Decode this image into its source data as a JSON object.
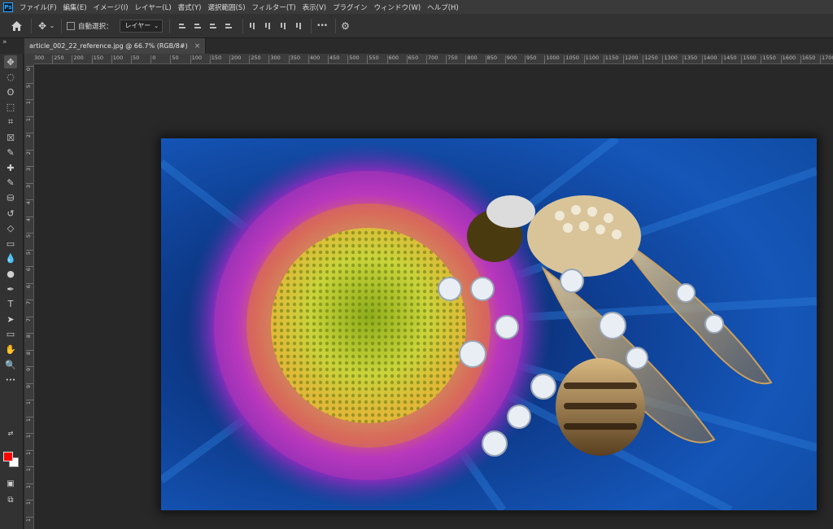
{
  "menubar": {
    "logo": "Ps",
    "items": [
      "ファイル(F)",
      "編集(E)",
      "イメージ(I)",
      "レイヤー(L)",
      "書式(Y)",
      "選択範囲(S)",
      "フィルター(T)",
      "表示(V)",
      "プラグイン",
      "ウィンドウ(W)",
      "ヘルプ(H)"
    ]
  },
  "options": {
    "auto_select_label": "自動選択：",
    "layer_select": "レイヤー",
    "more": "•••"
  },
  "document": {
    "tab_title": "article_002_22_reference.jpg @ 66.7% (RGB/8#)",
    "close": "×"
  },
  "ruler_h_labels": [
    "300",
    "250",
    "200",
    "150",
    "100",
    "50",
    "0",
    "50",
    "100",
    "150",
    "200",
    "250",
    "300",
    "350",
    "400",
    "450",
    "500",
    "550",
    "600",
    "650",
    "700",
    "750",
    "800",
    "850",
    "900",
    "950",
    "1000",
    "1050",
    "1100",
    "1150",
    "1200",
    "1250",
    "1300",
    "1350",
    "1400",
    "1450",
    "1500",
    "1550",
    "1600",
    "1650",
    "1700"
  ],
  "ruler_v_labels": [
    "0",
    "5",
    "1",
    "1",
    "2",
    "2",
    "3",
    "3",
    "4",
    "4",
    "5",
    "5",
    "6",
    "6",
    "7",
    "7",
    "8",
    "8",
    "9",
    "9",
    "1",
    "1",
    "1",
    "1",
    "1",
    "1",
    "1",
    "1"
  ],
  "tools": [
    "move-tool",
    "marquee-tool",
    "lasso-tool",
    "object-select-tool",
    "crop-tool",
    "frame-tool",
    "eyedropper-tool",
    "healing-brush-tool",
    "brush-tool",
    "clone-stamp-tool",
    "history-brush-tool",
    "eraser-tool",
    "gradient-tool",
    "blur-tool",
    "dodge-tool",
    "pen-tool",
    "type-tool",
    "path-select-tool",
    "shape-tool",
    "hand-tool",
    "zoom-tool",
    "more-tools"
  ],
  "tool_glyphs": [
    "✥",
    "◌",
    "ʘ",
    "⬚",
    "⌗",
    "☒",
    "✎",
    "✚",
    "✎",
    "⛁",
    "↺",
    "◇",
    "▭",
    "💧",
    "●",
    "✒",
    "T",
    "➤",
    "▭",
    "✋",
    "🔍",
    "•••"
  ],
  "colors": {
    "foreground": "#ff0000",
    "background": "#ffffff"
  }
}
